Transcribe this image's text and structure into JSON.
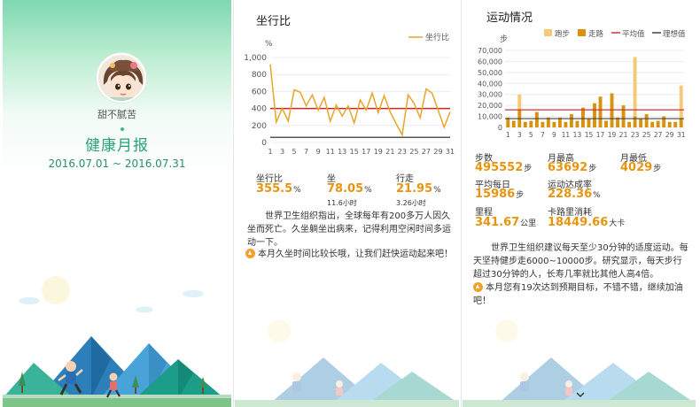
{
  "cover": {
    "username": "甜不腻苦",
    "report_title": "健康月报",
    "date_range": "2016.07.01 ~ 2016.07.31"
  },
  "sitting": {
    "title": "坐行比",
    "chart_data": {
      "type": "line",
      "ylabel": "%",
      "ylim": [
        0,
        1000
      ],
      "yticks": [
        0,
        200,
        400,
        600,
        800,
        1000
      ],
      "xticks": [
        1,
        3,
        5,
        7,
        9,
        11,
        13,
        15,
        17,
        19,
        21,
        23,
        25,
        27,
        29,
        31
      ],
      "legend_position": "top-right",
      "series": [
        {
          "name": "坐行比",
          "color": "#e8a52a",
          "x": [
            1,
            2,
            3,
            4,
            5,
            6,
            7,
            8,
            9,
            10,
            11,
            12,
            13,
            14,
            15,
            16,
            17,
            18,
            19,
            20,
            21,
            22,
            23,
            24,
            25,
            26,
            27,
            28,
            29,
            30,
            31
          ],
          "values": [
            920,
            240,
            400,
            250,
            620,
            590,
            430,
            560,
            380,
            530,
            250,
            440,
            310,
            430,
            230,
            500,
            380,
            580,
            350,
            550,
            360,
            220,
            90,
            560,
            460,
            290,
            630,
            580,
            380,
            180,
            360
          ]
        }
      ],
      "reference_lines": [
        {
          "value": 400,
          "color": "#cc2222"
        },
        {
          "value": 60,
          "color": "#555555"
        }
      ]
    },
    "stats": [
      {
        "label": "坐行比",
        "value": "355.5",
        "unit": "%"
      },
      {
        "label": "坐",
        "value": "78.05",
        "unit": "%",
        "sub": "11.6小时"
      },
      {
        "label": "行走",
        "value": "21.95",
        "unit": "%",
        "sub": "3.26小时"
      }
    ],
    "paragraph": "世界卫生组织指出，全球每年有200多万人因久坐而死亡。久坐躺坐出病来，记得利用空闲时间多运动一下。",
    "tip": "本月久坐时间比较长哦，让我们赶快运动起来吧！"
  },
  "exercise": {
    "title": "运动情况",
    "chart_data": {
      "type": "bar",
      "ylabel": "步",
      "ylim": [
        0,
        70000
      ],
      "yticks": [
        0,
        10000,
        20000,
        30000,
        40000,
        50000,
        60000,
        70000
      ],
      "xticks": [
        1,
        3,
        5,
        7,
        9,
        11,
        13,
        15,
        17,
        19,
        21,
        23,
        25,
        27,
        29,
        31
      ],
      "legend_position": "top-right",
      "stacked": true,
      "categories": [
        1,
        2,
        3,
        4,
        5,
        6,
        7,
        8,
        9,
        10,
        11,
        12,
        13,
        14,
        15,
        16,
        17,
        18,
        19,
        20,
        21,
        22,
        23,
        24,
        25,
        26,
        27,
        28,
        29,
        30,
        31
      ],
      "series": [
        {
          "name": "跑步",
          "color": "#f5c97a",
          "values": [
            0,
            0,
            14000,
            0,
            0,
            0,
            0,
            0,
            0,
            0,
            0,
            0,
            0,
            0,
            0,
            0,
            0,
            0,
            0,
            0,
            0,
            0,
            54000,
            0,
            0,
            0,
            0,
            0,
            0,
            0,
            30000
          ]
        },
        {
          "name": "走路",
          "color": "#d89210",
          "values": [
            9000,
            6000,
            16000,
            5000,
            6000,
            14000,
            5000,
            9000,
            5000,
            9000,
            5000,
            12000,
            6000,
            18000,
            8000,
            22000,
            28000,
            6000,
            31000,
            9000,
            20000,
            5000,
            10000,
            8000,
            12000,
            5000,
            6000,
            10000,
            5000,
            5000,
            8000
          ]
        }
      ],
      "reference_lines": [
        {
          "name": "平均值",
          "value": 16000,
          "color": "#cc3333"
        },
        {
          "name": "理想值",
          "value": 8000,
          "color": "#444444"
        }
      ]
    },
    "stats": [
      {
        "label": "步数",
        "value": "495552",
        "unit": "步"
      },
      {
        "label": "月最高",
        "value": "63692",
        "unit": "步"
      },
      {
        "label": "月最低",
        "value": "4029",
        "unit": "步"
      },
      {
        "label": "平均每日",
        "value": "15986",
        "unit": "步"
      },
      {
        "label": "运动达成率",
        "value": "228.36",
        "unit": "%"
      },
      {
        "label": "里程",
        "value": "341.67",
        "unit": "公里"
      },
      {
        "label": "卡路里消耗",
        "value": "18449.66",
        "unit": "大卡"
      }
    ],
    "paragraph": "世界卫生组织建议每天至少30分钟的适度运动。每天坚持健步走6000~10000步。研究显示，每天步行超过30分钟的人，长寿几率就比其他人高4倍。",
    "tip": "本月您有19次达到预期目标，不错不错，继续加油吧！"
  },
  "colors": {
    "accent_green": "#2aa175",
    "value_orange": "#e8940f"
  }
}
